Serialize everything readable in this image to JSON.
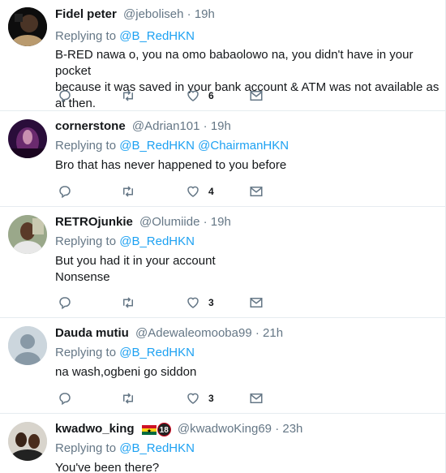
{
  "tweets": [
    {
      "name": "Fidel peter",
      "handle": "@jeboliseh",
      "sep": "·",
      "time": "19h",
      "replying_prefix": "Replying to ",
      "replying_to": [
        "@B_RedHKN"
      ],
      "text_lines": [
        "B-RED nawa o, you na omo babaolowo na, you didn't have in your pocket",
        "because it was saved in your bank account & ATM was not available as at then."
      ],
      "likes": "6"
    },
    {
      "name": "cornerstone",
      "handle": "@Adrian101",
      "sep": "·",
      "time": "19h",
      "replying_prefix": "Replying to ",
      "replying_to": [
        "@B_RedHKN",
        "@ChairmanHKN"
      ],
      "text_lines": [
        "Bro that has never happened to you before"
      ],
      "likes": "4"
    },
    {
      "name": "RETROjunkie",
      "handle": "@Olumiide",
      "sep": "·",
      "time": "19h",
      "replying_prefix": "Replying to ",
      "replying_to": [
        "@B_RedHKN"
      ],
      "text_lines": [
        "But you had it in your account",
        "Nonsense"
      ],
      "likes": "3"
    },
    {
      "name": "Dauda mutiu",
      "handle": "@Adewaleomooba99",
      "sep": "·",
      "time": "21h",
      "replying_prefix": "Replying to ",
      "replying_to": [
        "@B_RedHKN"
      ],
      "text_lines": [
        "na wash,ogbeni go siddon"
      ],
      "likes": "3"
    },
    {
      "name": "kwadwo_king",
      "handle": "@kwadwoKing69",
      "sep": "·",
      "time": "23h",
      "badge": "18",
      "replying_prefix": "Replying to ",
      "replying_to": [
        "@B_RedHKN"
      ],
      "text_lines": [
        "You've been there?"
      ],
      "likes": ""
    }
  ],
  "colors": {
    "link": "#1da1f2",
    "muted": "#657786",
    "text": "#14171a",
    "border": "#e6ecf0"
  },
  "icons": {
    "reply": "reply-icon",
    "retweet": "retweet-icon",
    "like": "heart-icon",
    "dm": "envelope-icon"
  }
}
